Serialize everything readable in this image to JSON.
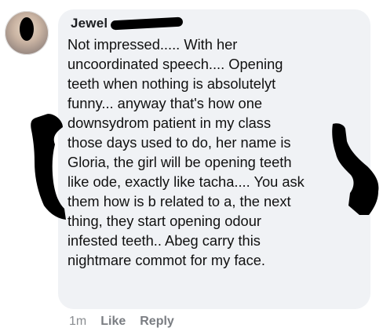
{
  "comment": {
    "author": "Jewel",
    "lines": [
      "Not impressed..... With her",
      "uncoordinated speech.... Opening",
      "teeth when nothing is absolutelyt",
      "funny... anyway that's how one",
      "downsydrom patient in my class",
      "those days used to do, her name is",
      "Gloria, the girl will be opening teeth",
      "like ode, exactly like tacha.... You ask",
      "them how is b related to a, the next",
      "thing, they start opening odour",
      "infested teeth.. Abeg carry this",
      "nightmare commot for my face."
    ]
  },
  "footer": {
    "time": "1m",
    "like_label": "Like",
    "reply_label": "Reply"
  },
  "colors": {
    "bubble_background": "#f0f2f5",
    "redaction": "#000000",
    "meta_text": "#65676b"
  }
}
